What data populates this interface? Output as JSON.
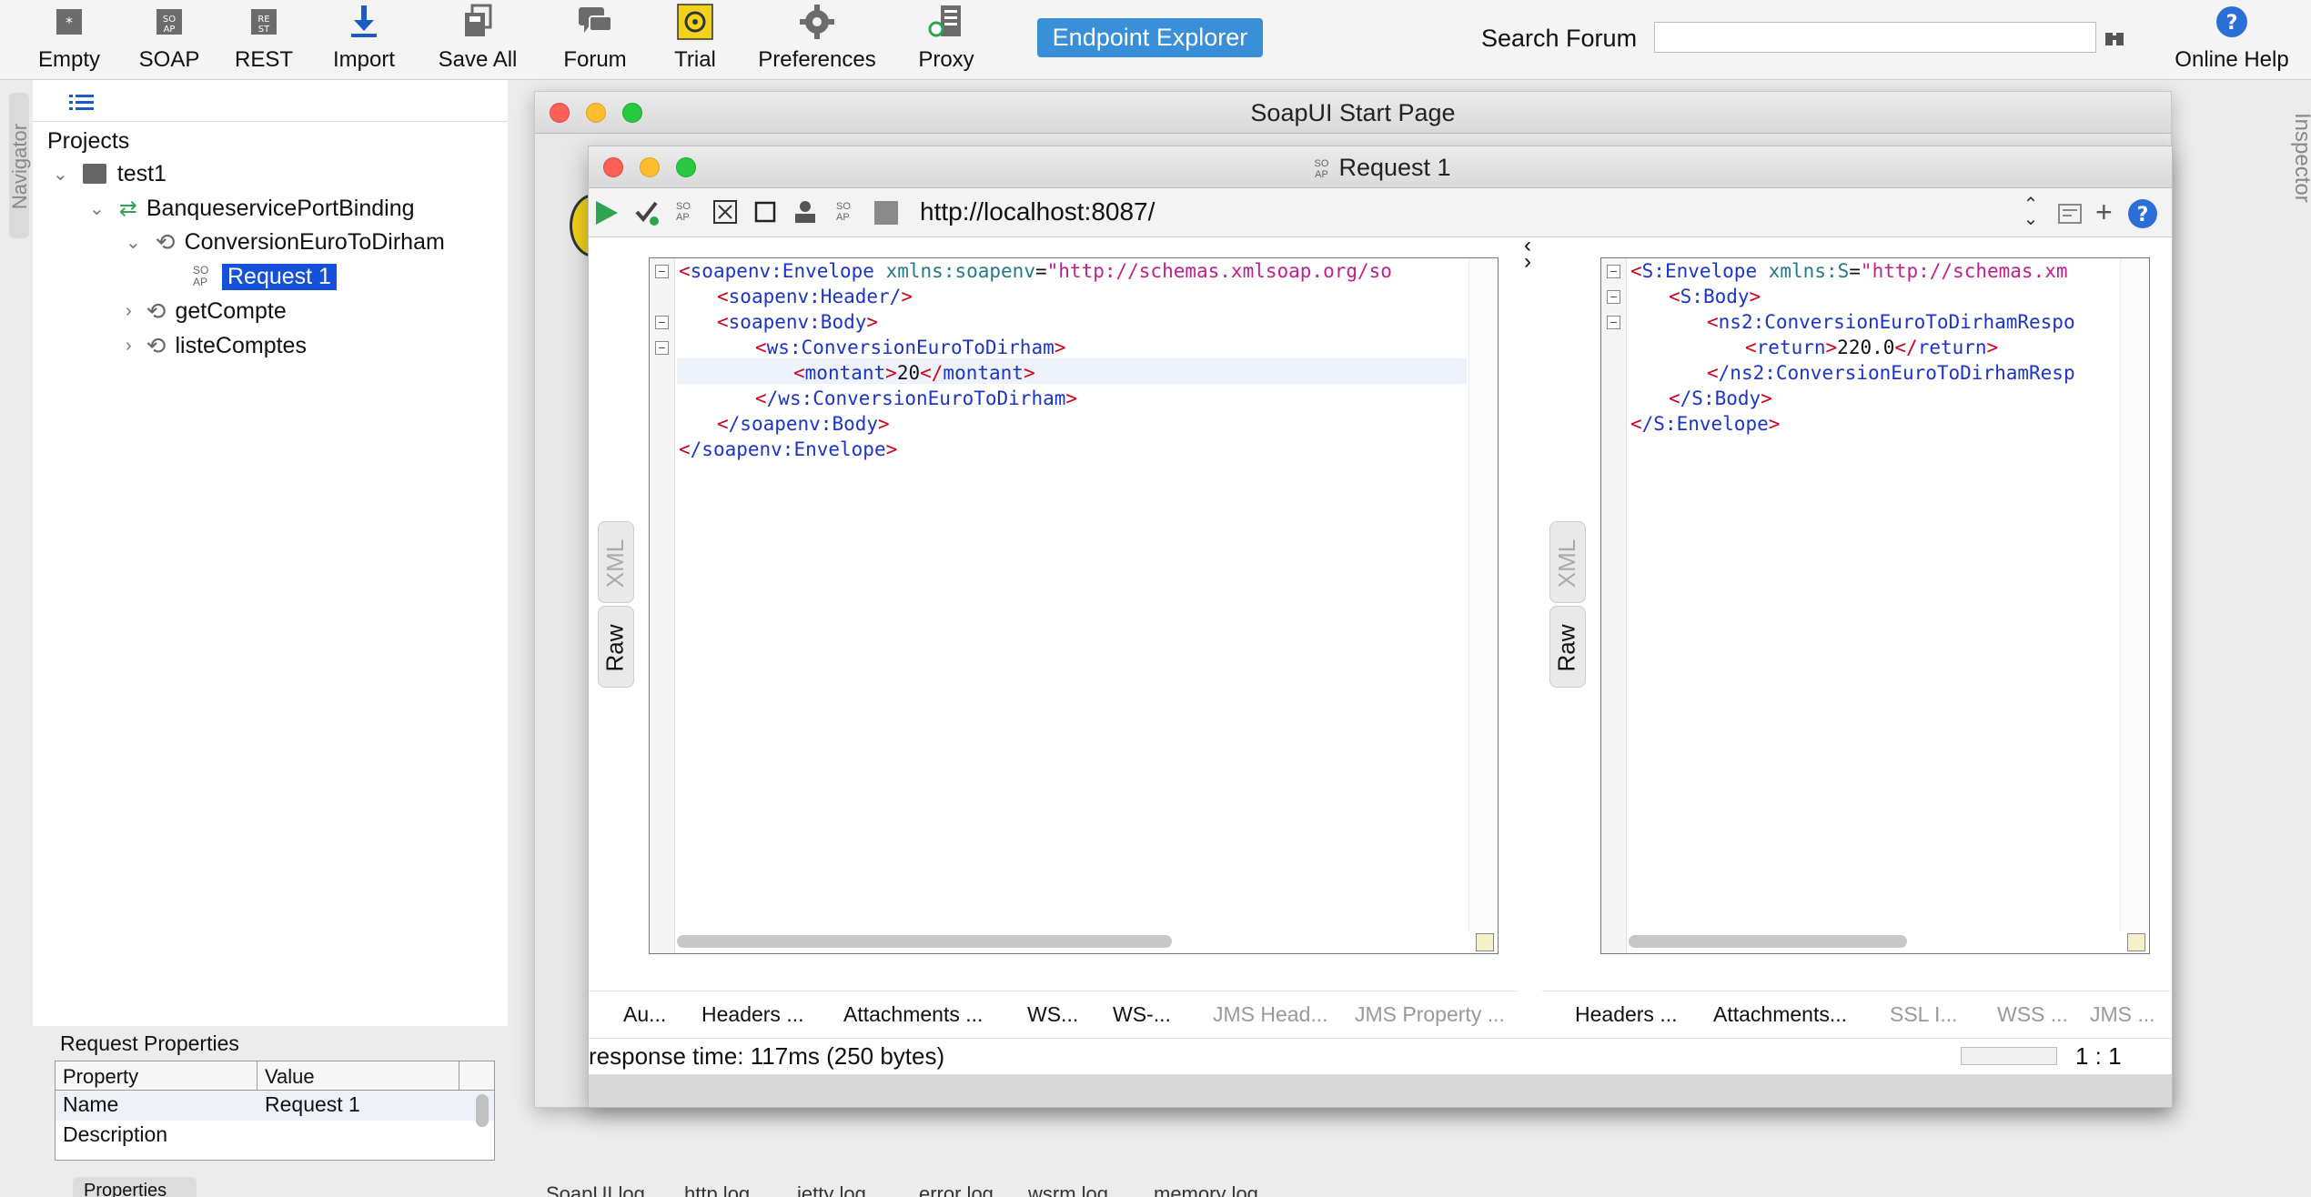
{
  "toolbar": {
    "buttons": [
      {
        "label": "Empty",
        "icon": "empty-project-icon"
      },
      {
        "label": "SOAP",
        "icon": "soap-icon"
      },
      {
        "label": "REST",
        "icon": "rest-icon"
      },
      {
        "label": "Import",
        "icon": "import-icon"
      },
      {
        "label": "Save All",
        "icon": "save-all-icon"
      },
      {
        "label": "Forum",
        "icon": "forum-icon"
      },
      {
        "label": "Trial",
        "icon": "trial-icon"
      },
      {
        "label": "Preferences",
        "icon": "gear-icon"
      },
      {
        "label": "Proxy",
        "icon": "proxy-icon"
      }
    ],
    "endpoint_explorer": "Endpoint Explorer",
    "search_label": "Search Forum",
    "search_value": "",
    "online_help": "Online Help"
  },
  "navigator": {
    "tab_label": "Navigator",
    "projects_label": "Projects",
    "tree": {
      "project": "test1",
      "binding": "BanqueservicePortBinding",
      "operation": "ConversionEuroToDirham",
      "request": "Request 1",
      "op2": "getCompte",
      "op3": "listeComptes",
      "soap_badge": "SO AP"
    }
  },
  "request_properties": {
    "title": "Request Properties",
    "col_property": "Property",
    "col_value": "Value",
    "rows": [
      {
        "property": "Name",
        "value": "Request 1"
      },
      {
        "property": "Description",
        "value": ""
      }
    ]
  },
  "inspector_label": "Inspector",
  "start_page": {
    "title": "SoapUI Start Page"
  },
  "request_window": {
    "title": "Request 1",
    "url": "http://localhost:8087/",
    "request_xml": {
      "l1_tag": "soapenv:Envelope",
      "l1_attr": "xmlns:soapenv",
      "l1_val": "\"http://schemas.xmlsoap.org/so",
      "l2": "soapenv:Header/",
      "l3": "soapenv:Body",
      "l4": "ws:ConversionEuroToDirham",
      "l5_tag": "montant",
      "l5_val": "20",
      "l6": "/ws:ConversionEuroToDirham",
      "l7": "/soapenv:Body",
      "l8": "/soapenv:Envelope"
    },
    "response_xml": {
      "l1_tag": "S:Envelope",
      "l1_attr": "xmlns:S",
      "l1_val": "\"http://schemas.xm",
      "l2": "S:Body",
      "l3": "ns2:ConversionEuroToDirhamRespo",
      "l4_tag": "return",
      "l4_val": "220.0",
      "l5": "/ns2:ConversionEuroToDirhamResp",
      "l6": "/S:Body",
      "l7": "/S:Envelope"
    },
    "side_tabs": {
      "xml": "XML",
      "raw": "Raw"
    },
    "request_tabs": [
      "Au...",
      "Headers ...",
      "Attachments ...",
      "WS...",
      "WS-...",
      "JMS Head...",
      "JMS Property ..."
    ],
    "response_tabs": [
      "Headers ...",
      "Attachments...",
      "SSL I...",
      "WSS ...",
      "JMS ..."
    ],
    "status": "response time: 117ms (250 bytes)",
    "position": "1 : 1"
  },
  "bottom_log_tabs": [
    "SoapUI log",
    "http log",
    "jetty log",
    "error log",
    "wsrm log",
    "memory log"
  ],
  "properties_tab": "Properties",
  "colors": {
    "accent": "#3a8fd9",
    "selection": "#1450d8",
    "xml_tag": "#1b34c9",
    "xml_bracket": "#d0021b"
  }
}
